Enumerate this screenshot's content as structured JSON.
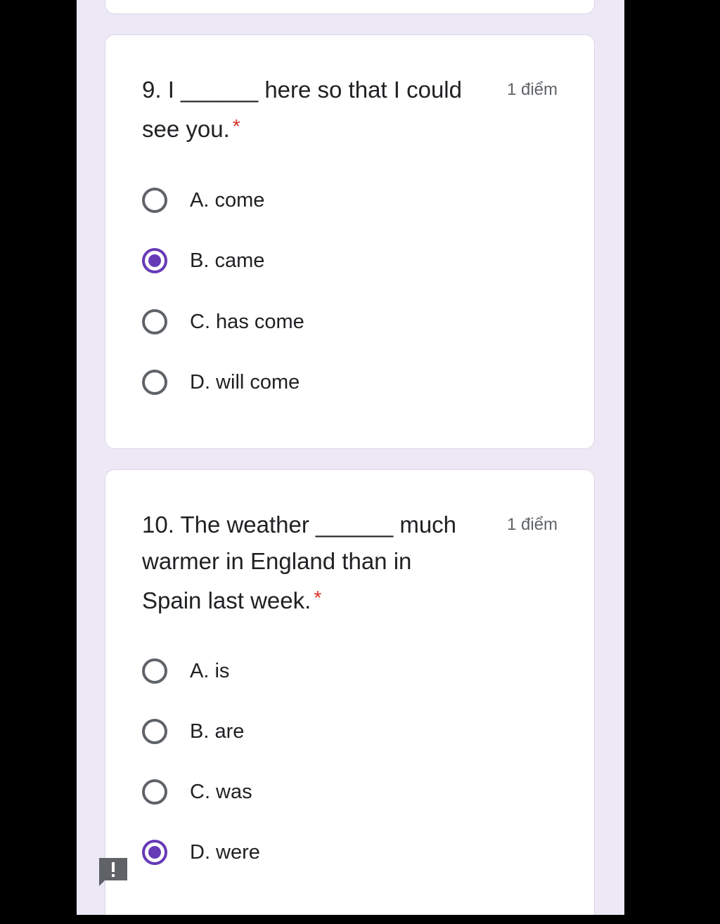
{
  "questions": [
    {
      "title_line1": "9. I ______ here so that I could",
      "title_line2": "see you.",
      "required_mark": "*",
      "points": "1 điểm",
      "options": [
        {
          "label": "A. come",
          "checked": false
        },
        {
          "label": "B. came",
          "checked": true
        },
        {
          "label": "C. has come",
          "checked": false
        },
        {
          "label": "D. will come",
          "checked": false
        }
      ]
    },
    {
      "title_line1": "10. The weather ______ much",
      "title_line2": "warmer in England than in",
      "title_line3": "Spain last week.",
      "required_mark": "*",
      "points": "1 điểm",
      "options": [
        {
          "label": "A. is",
          "checked": false
        },
        {
          "label": "B. are",
          "checked": false
        },
        {
          "label": "C. was",
          "checked": false
        },
        {
          "label": "D. were",
          "checked": true
        }
      ]
    }
  ],
  "feedback_icon": "report-problem-icon",
  "colors": {
    "accent": "#673ab7",
    "background": "#ece8f6",
    "required": "#d93025"
  }
}
